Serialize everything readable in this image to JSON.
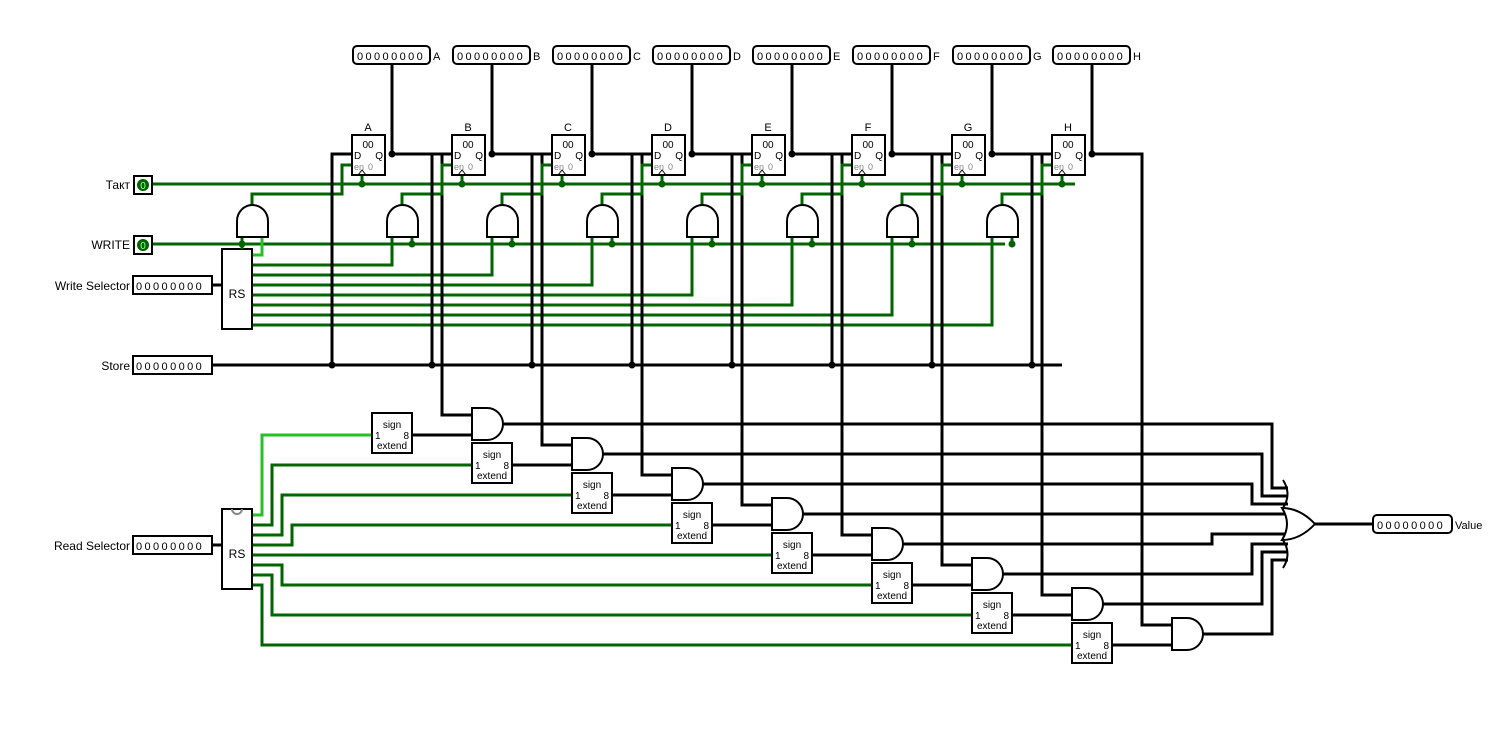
{
  "inputs": {
    "clock": {
      "label": "Такт",
      "value": "0"
    },
    "write": {
      "label": "WRITE",
      "value": "0"
    },
    "write_selector": {
      "label": "Write Selector",
      "value": "00000000"
    },
    "store": {
      "label": "Store",
      "value": "00000000"
    },
    "read_selector": {
      "label": "Read Selector",
      "value": "00000000"
    }
  },
  "registers": [
    {
      "name": "A",
      "value": "00",
      "probe": "00000000"
    },
    {
      "name": "B",
      "value": "00",
      "probe": "00000000"
    },
    {
      "name": "C",
      "value": "00",
      "probe": "00000000"
    },
    {
      "name": "D",
      "value": "00",
      "probe": "00000000"
    },
    {
      "name": "E",
      "value": "00",
      "probe": "00000000"
    },
    {
      "name": "F",
      "value": "00",
      "probe": "00000000"
    },
    {
      "name": "G",
      "value": "00",
      "probe": "00000000"
    },
    {
      "name": "H",
      "value": "00",
      "probe": "00000000"
    }
  ],
  "register_pins": {
    "d": "D",
    "q": "Q",
    "en": "en",
    "zero": "0"
  },
  "decoder_label": "RS",
  "sign_extend": {
    "top": "sign",
    "bottom": "extend",
    "in_width": "1",
    "out_width": "8"
  },
  "output": {
    "label": "Value",
    "value": "00000000"
  },
  "colors": {
    "wire_bus": "#000000",
    "wire_low": "#006400",
    "wire_high": "#22c322"
  }
}
